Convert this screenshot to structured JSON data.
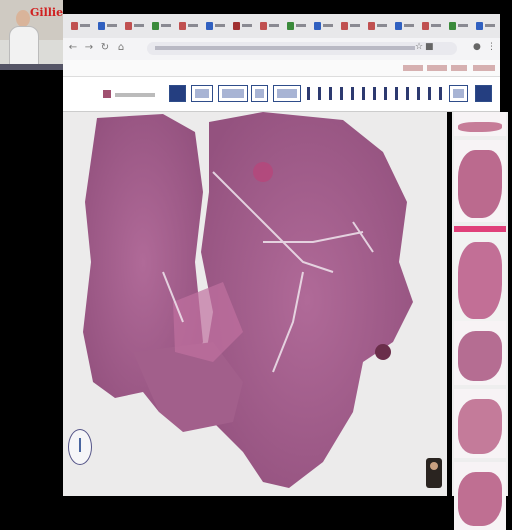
{
  "webcam": {
    "logo_text": "Gillies"
  },
  "browser": {
    "tabs": [
      {
        "favicon_color": "#c05050"
      },
      {
        "favicon_color": "#3060c0"
      },
      {
        "favicon_color": "#c05050"
      },
      {
        "favicon_color": "#3a8a3a"
      },
      {
        "favicon_color": "#c05050"
      },
      {
        "favicon_color": "#3060c0"
      },
      {
        "favicon_color": "#a03030"
      },
      {
        "favicon_color": "#c05050"
      },
      {
        "favicon_color": "#3a8a3a"
      },
      {
        "favicon_color": "#3060c0"
      },
      {
        "favicon_color": "#c05050"
      },
      {
        "favicon_color": "#c05050"
      },
      {
        "favicon_color": "#3060c0"
      },
      {
        "favicon_color": "#c05050"
      },
      {
        "favicon_color": "#3a8a3a"
      },
      {
        "favicon_color": "#3060c0"
      }
    ],
    "nav_icons": [
      "back-arrow-icon",
      "forward-arrow-icon",
      "reload-icon"
    ]
  },
  "viewer": {
    "accent_color": "#243e80",
    "tissue_color": "#a35a8c"
  },
  "thumbnails": [
    {
      "tissue_color": "#c67c98"
    },
    {
      "tissue_color": "#bb6a8e"
    },
    {
      "tissue_color": "#c26f96"
    },
    {
      "tissue_color": "#b56d92"
    },
    {
      "tissue_color": "#c47b9a"
    },
    {
      "tissue_color": "#bf6f92"
    }
  ]
}
